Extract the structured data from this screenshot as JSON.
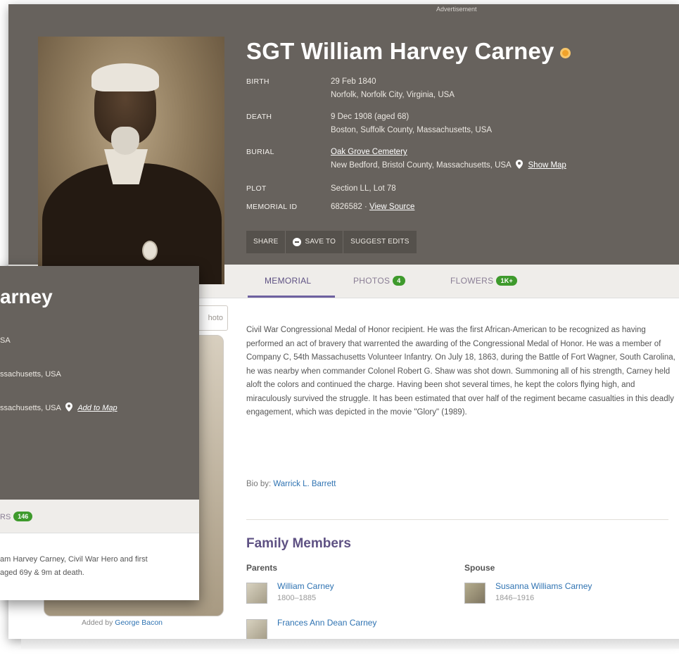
{
  "ad_label": "Advertisement",
  "main": {
    "name": "SGT William Harvey Carney",
    "birth": {
      "label": "BIRTH",
      "date": "29 Feb 1840",
      "place": "Norfolk, Norfolk City, Virginia, USA"
    },
    "death": {
      "label": "DEATH",
      "date": "9 Dec 1908 (aged 68)",
      "place": "Boston, Suffolk County, Massachusetts, USA"
    },
    "burial": {
      "label": "BURIAL",
      "cemetery": "Oak Grove Cemetery",
      "place": "New Bedford, Bristol County, Massachusetts, USA",
      "show_map": "Show Map"
    },
    "plot": {
      "label": "PLOT",
      "value": "Section LL, Lot 78"
    },
    "memorial_id": {
      "label": "MEMORIAL ID",
      "value": "6826582 · ",
      "view_source": "View Source"
    },
    "actions": {
      "share": "SHARE",
      "save_to": "SAVE TO",
      "suggest_edits": "SUGGEST EDITS"
    },
    "tabs": {
      "memorial": "MEMORIAL",
      "photos": "PHOTOS",
      "photos_count": "4",
      "flowers": "FLOWERS",
      "flowers_count": "1K+"
    },
    "bio": "Civil War Congressional Medal of Honor recipient. He was the first African-American to be recognized as having performed an act of bravery that warrented the awarding of the Congressional Medal of Honor. He was a member of Company C, 54th Massachusetts Volunteer Infantry. On July 18, 1863, during the Battle of Fort Wagner, South Carolina, he was nearby when commander Colonel Robert G. Shaw was shot down. Summoning all of his strength, Carney held aloft the colors and continued the charge. Having been shot several times, he kept the colors flying high, and miraculously survived the struggle. It has been estimated that over half of the regiment became casualties in this deadly engagement, which was depicted in the movie \"Glory\" (1989).",
    "bio_by_label": "Bio by: ",
    "bio_by_name": "Warrick L. Barrett",
    "family": {
      "title": "Family Members",
      "parents_label": "Parents",
      "spouse_label": "Spouse",
      "parents": [
        {
          "name": "William Carney",
          "dates": "1800–1885"
        },
        {
          "name": "Frances Ann Dean Carney",
          "dates": ""
        }
      ],
      "spouse": {
        "name": "Susanna Williams Carney",
        "dates": "1846–1916"
      }
    },
    "add_photo_fragment": "hoto",
    "added_by_label": "Added by ",
    "added_by_name": "George Bacon"
  },
  "overlay": {
    "name_fragment": "arney",
    "line1": "SA",
    "line2": "ssachusetts, USA",
    "line3_text": "ssachusetts, USA",
    "add_to_map": "Add to Map",
    "tab_fragment": "RS",
    "tab_count": "146",
    "text_line1": "am Harvey Carney, Civil War Hero and first",
    "text_line2": "aged 69y & 9m at death."
  },
  "colors": {
    "hero_bg": "#67625d",
    "accent_purple": "#5e5183",
    "link_blue": "#2f73b2",
    "badge_green": "#3e9a2c",
    "famous_orange": "#f0a22a"
  }
}
